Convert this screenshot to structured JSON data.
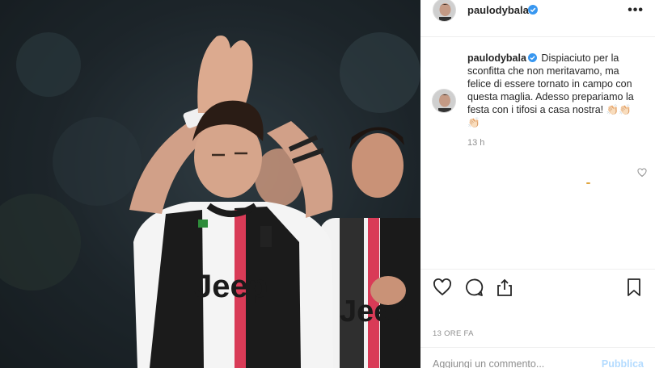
{
  "post": {
    "username": "paulodybala",
    "caption_user": "paulodybala",
    "caption": "Dispiaciuto per la sconfitta che non meritavamo, ma felice di essere tornato in campo con questa maglia. Adesso prepariamo la festa con i tifosi a casa nostra! 👏🏻👏🏻👏🏻",
    "relative_time": "13 h",
    "posted_ago": "13 ORE FA"
  },
  "comment_box": {
    "placeholder": "Aggiungi un commento...",
    "publish_label": "Pubblica"
  },
  "photo": {
    "shirt_brand": "Jeep",
    "shirt_brand_2": "Jeep"
  },
  "colors": {
    "verified": "#3897f0",
    "publish_disabled": "#b3dbff",
    "muted_text": "#8e8e8e",
    "divider": "#efefef"
  },
  "icons": {
    "more": "more-horizontal-icon",
    "like": "heart-icon",
    "comment": "comment-bubble-icon",
    "share": "share-icon",
    "save": "bookmark-icon",
    "verified": "verified-badge-icon"
  }
}
